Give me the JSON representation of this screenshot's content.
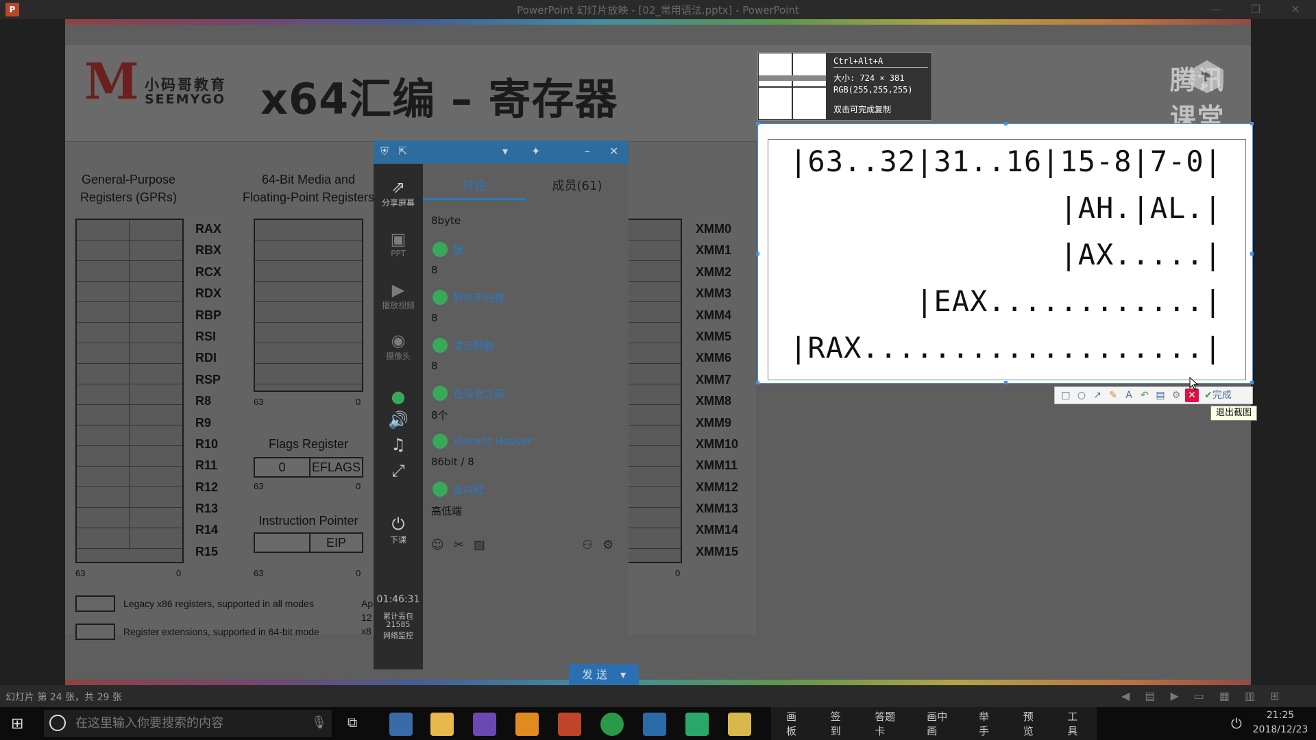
{
  "window": {
    "title": "PowerPoint 幻灯片放映 - [02_常用语法.pptx] - PowerPoint",
    "app_icon": "P"
  },
  "slide": {
    "logo_cn": "小码哥教育",
    "logo_en": "SEEMYGO",
    "title": "x64汇编 – 寄存器",
    "gpr_header": "General-Purpose\nRegisters (GPRs)",
    "media_header": "64-Bit Media and\nFloating-Point Registers",
    "gprs": [
      "RAX",
      "RBX",
      "RCX",
      "RDX",
      "RBP",
      "RSI",
      "RDI",
      "RSP",
      "R8",
      "R9",
      "R10",
      "R11",
      "R12",
      "R13",
      "R14",
      "R15"
    ],
    "xmm": [
      "XMM0",
      "XMM1",
      "XMM2",
      "XMM3",
      "XMM4",
      "XMM5",
      "XMM6",
      "XMM7",
      "XMM8",
      "XMM9",
      "XMM10",
      "XMM11",
      "XMM12",
      "XMM13",
      "XMM14",
      "XMM15"
    ],
    "bit_hi": "63",
    "bit_lo": "0",
    "flags_title": "Flags Register",
    "flags_value": "0",
    "flags_name": "EFLAGS",
    "ip_title": "Instruction Pointer",
    "ip_name": "EIP",
    "legend1": "Legacy x86 registers, supported in all modes",
    "legend2": "Register extensions, supported in 64-bit mode",
    "cutoff1": "Ap",
    "cutoff2": "12",
    "cutoff3": "x8"
  },
  "watermark": "腾讯课堂",
  "magnifier": {
    "shortcut": "Ctrl+Alt+A",
    "size": "大小: 724 × 381",
    "rgb": "RGB(255,255,255)",
    "hint": "双击可完成复制"
  },
  "capture": {
    "lines": [
      "|63..32|31..16|15-8|7-0|",
      "|AH.|AL.|",
      "|AX.....|",
      "|EAX............|",
      "|RAX...................|"
    ]
  },
  "screenshot_toolbar": {
    "done_label": "完成",
    "tooltip": "退出截图"
  },
  "chat": {
    "tab_discuss": "讨论",
    "tab_members": "成员(61)",
    "side": {
      "share": "分享屏幕",
      "ppt": "PPT",
      "video": "播放视频",
      "camera": "摄像头",
      "end": "下课",
      "timer": "01:46:31",
      "lost1": "累计丢包",
      "lost2": "21585",
      "net": "网络监控"
    },
    "messages": [
      {
        "name": "",
        "text": "8byte"
      },
      {
        "name": "狼",
        "text": "8"
      },
      {
        "name": "醉也不归楼",
        "text": "8"
      },
      {
        "name": "凌云野鹤",
        "text": "8"
      },
      {
        "name": "在没老之前",
        "text": "8个"
      },
      {
        "name": "Vincent Hoover",
        "text": "86bit / 8"
      },
      {
        "name": "苗兴旺",
        "text": "高低端"
      }
    ],
    "send_label": "发 送"
  },
  "statusbar": {
    "slide_info": "幻灯片 第 24 张，共 29 张"
  },
  "taskbar": {
    "search_placeholder": "在这里输入你要搜索的内容",
    "class_tools": [
      "画板",
      "签到",
      "答题卡",
      "画中画",
      "举手",
      "预览",
      "工具"
    ],
    "time": "21:25",
    "date": "2018/12/23"
  }
}
